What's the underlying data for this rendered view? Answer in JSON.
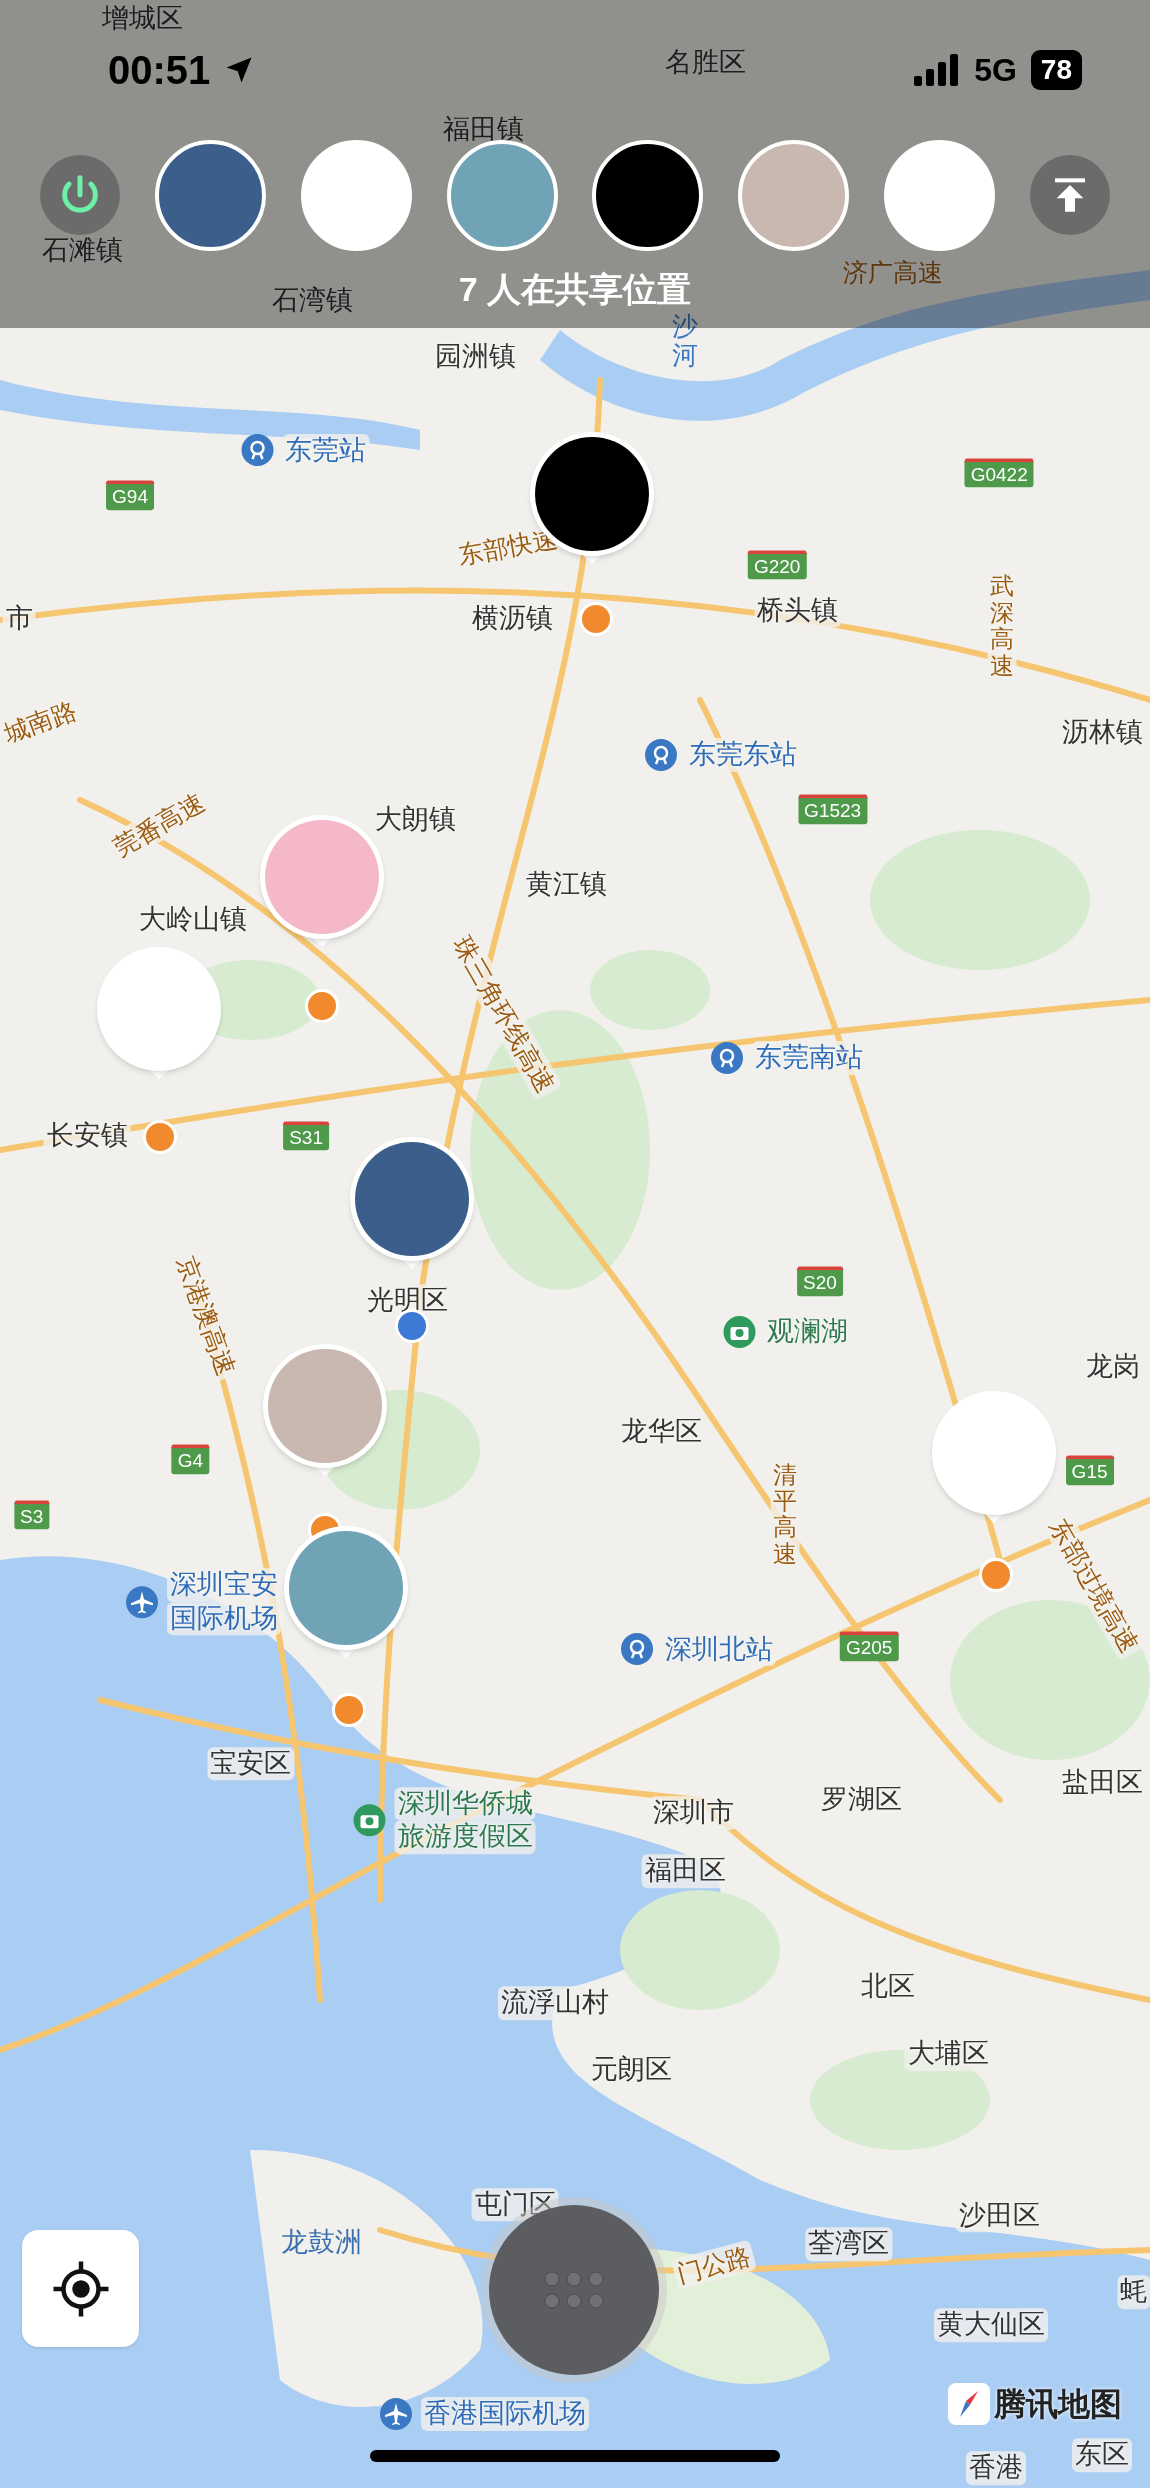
{
  "status_bar": {
    "time": "00:51",
    "network": "5G",
    "battery": "78"
  },
  "sharing_bar": {
    "caption": "7 人在共享位置"
  },
  "map": {
    "labels": [
      {
        "text": "增城区",
        "kind": "place"
      },
      {
        "text": "名胜区",
        "kind": "place"
      },
      {
        "text": "福田镇",
        "kind": "place"
      },
      {
        "text": "石滩镇",
        "kind": "place"
      },
      {
        "text": "石湾镇",
        "kind": "place"
      },
      {
        "text": "济广高速",
        "kind": "road"
      },
      {
        "text": "园洲镇",
        "kind": "place"
      },
      {
        "text": "沙河",
        "kind": "river"
      },
      {
        "text": "东莞站",
        "kind": "station"
      },
      {
        "text": "G94",
        "kind": "shield"
      },
      {
        "text": "G0422",
        "kind": "shield"
      },
      {
        "text": "东部快速",
        "kind": "road"
      },
      {
        "text": "G220",
        "kind": "shield"
      },
      {
        "text": "市",
        "kind": "place"
      },
      {
        "text": "横沥镇",
        "kind": "place"
      },
      {
        "text": "桥头镇",
        "kind": "place"
      },
      {
        "text": "武深高速",
        "kind": "vroad"
      },
      {
        "text": "城南路",
        "kind": "road"
      },
      {
        "text": "沥林镇",
        "kind": "place"
      },
      {
        "text": "东莞东站",
        "kind": "station"
      },
      {
        "text": "G1523",
        "kind": "shield"
      },
      {
        "text": "莞番高速",
        "kind": "road"
      },
      {
        "text": "大朗镇",
        "kind": "place"
      },
      {
        "text": "黄江镇",
        "kind": "place"
      },
      {
        "text": "大岭山镇",
        "kind": "place"
      },
      {
        "text": "珠三角环线高速",
        "kind": "road"
      },
      {
        "text": "东莞南站",
        "kind": "station"
      },
      {
        "text": "长安镇",
        "kind": "place"
      },
      {
        "text": "S31",
        "kind": "shield"
      },
      {
        "text": "京港澳高速",
        "kind": "road"
      },
      {
        "text": "光明区",
        "kind": "place"
      },
      {
        "text": "S20",
        "kind": "shield"
      },
      {
        "text": "观澜湖",
        "kind": "scenic"
      },
      {
        "text": "龙岗",
        "kind": "place"
      },
      {
        "text": "龙华区",
        "kind": "place"
      },
      {
        "text": "G4",
        "kind": "shield"
      },
      {
        "text": "G15",
        "kind": "shield"
      },
      {
        "text": "S3",
        "kind": "shield"
      },
      {
        "text": "清平高速",
        "kind": "vroad"
      },
      {
        "text": "东部过境高速",
        "kind": "road"
      },
      {
        "lines": [
          "深圳宝安",
          "国际机场"
        ],
        "kind": "airport"
      },
      {
        "text": "深圳北站",
        "kind": "station"
      },
      {
        "text": "G205",
        "kind": "shield"
      },
      {
        "text": "宝安区",
        "kind": "place"
      },
      {
        "lines": [
          "深圳华侨城",
          "旅游度假区"
        ],
        "kind": "scenic"
      },
      {
        "text": "深圳市",
        "kind": "place"
      },
      {
        "text": "罗湖区",
        "kind": "place"
      },
      {
        "text": "盐田区",
        "kind": "place"
      },
      {
        "text": "福田区",
        "kind": "place"
      },
      {
        "text": "北区",
        "kind": "place"
      },
      {
        "text": "流浮山村",
        "kind": "place"
      },
      {
        "text": "大埔区",
        "kind": "place"
      },
      {
        "text": "元朗区",
        "kind": "place"
      },
      {
        "text": "屯门区",
        "kind": "place"
      },
      {
        "text": "沙田区",
        "kind": "place"
      },
      {
        "text": "龙鼓洲",
        "kind": "water"
      },
      {
        "text": "荃湾区",
        "kind": "place"
      },
      {
        "text": "门公路",
        "kind": "road"
      },
      {
        "text": "蚝",
        "kind": "place"
      },
      {
        "text": "黄大仙区",
        "kind": "place"
      },
      {
        "text": "香港国际机场",
        "kind": "airport"
      },
      {
        "text": "香港",
        "kind": "place"
      },
      {
        "text": "东区",
        "kind": "place"
      }
    ],
    "markers": [
      {
        "color": "#f08a2c"
      },
      {
        "color": "#f08a2c"
      },
      {
        "color": "#f08a2c"
      },
      {
        "color": "#3d7bd6"
      },
      {
        "color": "#f08a2c"
      },
      {
        "color": "#f08a2c"
      },
      {
        "color": "#f08a2c"
      }
    ]
  },
  "logo": {
    "text": "腾讯地图"
  }
}
